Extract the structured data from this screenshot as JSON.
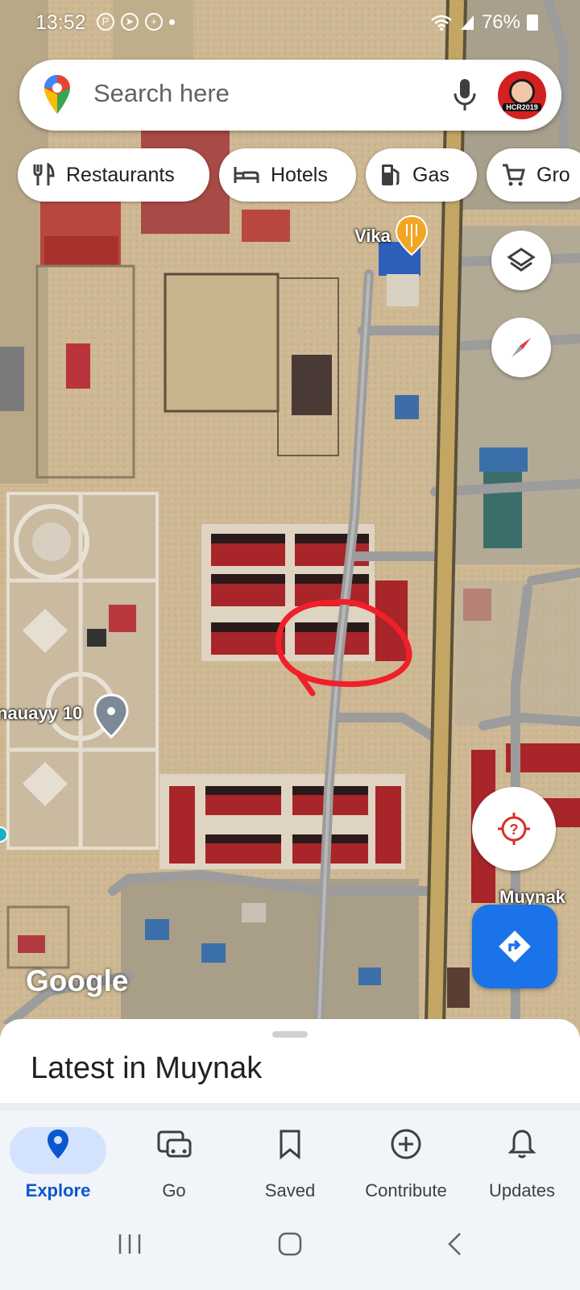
{
  "status_bar": {
    "time": "13:52",
    "battery": "76%",
    "icons": [
      "pinterest-icon",
      "telegram-icon",
      "whatsapp-icon",
      "dot-icon",
      "wifi-icon",
      "signal-icon",
      "battery-icon"
    ]
  },
  "search": {
    "placeholder": "Search here",
    "icons": [
      "maps-pin-icon",
      "mic-icon",
      "avatar-icon"
    ],
    "avatar_text": "HCR2019"
  },
  "chips": [
    {
      "label": "Restaurants",
      "icon": "fork-knife-icon"
    },
    {
      "label": "Hotels",
      "icon": "bed-icon"
    },
    {
      "label": "Gas",
      "icon": "gas-pump-icon"
    },
    {
      "label": "Gro",
      "icon": "cart-icon"
    }
  ],
  "map": {
    "place_labels": [
      {
        "text": "Vika",
        "icon": "restaurant-pin-icon"
      },
      {
        "text": "nauayy 10",
        "icon": "gray-pin-icon"
      },
      {
        "text": "Muynak"
      }
    ],
    "watermark": "Google",
    "annotation_color": "#f0202a",
    "road_color": "#c3a664",
    "street_color": "#9c9c9c"
  },
  "buttons": {
    "layers": "layers-icon",
    "compass": "compass-icon",
    "my_location": "my-location-icon",
    "directions": "directions-icon"
  },
  "sheet": {
    "title": "Latest in Muynak"
  },
  "bottom_nav": [
    {
      "label": "Explore",
      "icon": "explore-pin-icon",
      "active": true
    },
    {
      "label": "Go",
      "icon": "car-icon",
      "active": false
    },
    {
      "label": "Saved",
      "icon": "bookmark-icon",
      "active": false
    },
    {
      "label": "Contribute",
      "icon": "add-circle-icon",
      "active": false
    },
    {
      "label": "Updates",
      "icon": "bell-icon",
      "active": false
    }
  ],
  "system_nav": [
    "recents-icon",
    "home-icon",
    "back-icon"
  ],
  "colors": {
    "accent": "#1a73e8",
    "active_pill": "#d3e3fd",
    "active_text": "#0b57d0"
  }
}
